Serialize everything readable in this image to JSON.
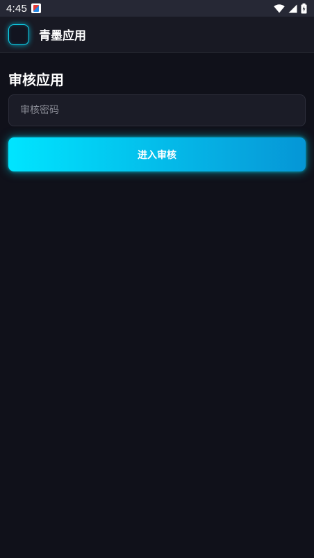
{
  "status_bar": {
    "time": "4:45",
    "icons": [
      "notification-app-icon",
      "wifi-icon",
      "cellular-signal-icon",
      "battery-charging-icon"
    ]
  },
  "app_bar": {
    "title": "青墨应用",
    "logo_icon": "app-logo-icon",
    "accent_color": "#00e5ff"
  },
  "main": {
    "section_title": "审核应用",
    "password_field": {
      "value": "",
      "placeholder": "审核密码"
    },
    "submit_button": {
      "label": "进入审核"
    }
  },
  "colors": {
    "background": "#10111a",
    "app_bar": "#181923",
    "status_bar": "#262835",
    "input_background": "#1b1c27",
    "button_gradient_start": "#00e5ff",
    "button_gradient_end": "#0596d6"
  }
}
